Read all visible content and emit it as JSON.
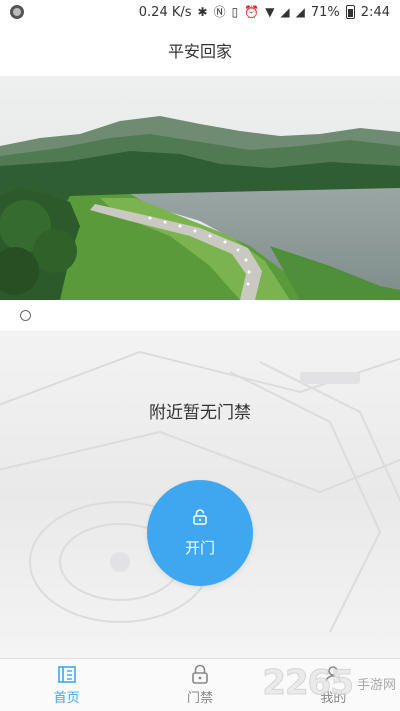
{
  "status_bar": {
    "speed": "0.24 K/s",
    "battery_pct": "71%",
    "time": "2:44"
  },
  "header": {
    "title": "平安回家"
  },
  "banner": {
    "page_indicator_active": 0
  },
  "main": {
    "empty_text": "附近暂无门禁",
    "open_button_label": "开门"
  },
  "tabs": [
    {
      "label": "首页",
      "icon": "home-icon",
      "active": true
    },
    {
      "label": "门禁",
      "icon": "lock-icon",
      "active": false
    },
    {
      "label": "我的",
      "icon": "user-icon",
      "active": false
    }
  ],
  "watermark": {
    "number": "2265",
    "text": "手游网"
  },
  "colors": {
    "accent": "#3fa7f0"
  }
}
